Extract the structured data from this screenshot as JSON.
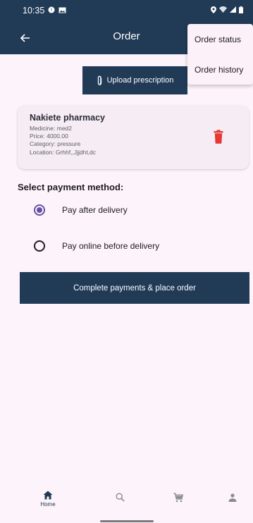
{
  "status_bar": {
    "time": "10:35"
  },
  "app_bar": {
    "title": "Order"
  },
  "menu": {
    "items": [
      "Order status",
      "Order history"
    ]
  },
  "upload": {
    "label": "Upload prescription"
  },
  "order_card": {
    "pharmacy": "Nakiete pharmacy",
    "medicine": "Medicine: med2",
    "price": "Price: 4000.00",
    "category": "Category: pressure",
    "location": "Location: Grhhf,,Jjjdht,dc"
  },
  "payment": {
    "title": "Select payment method:",
    "options": [
      "Pay after delivery",
      "Pay online before delivery"
    ],
    "selected_index": 0
  },
  "place_order": {
    "label": "Complete payments & place order"
  },
  "bottom_nav": {
    "items": [
      "Home"
    ]
  },
  "colors": {
    "primary": "#213a56",
    "radio_selected": "#6750a4",
    "delete": "#e53935",
    "background": "#fdf4fb"
  },
  "icons": [
    "back-arrow-icon",
    "paperclip-icon",
    "trash-icon",
    "home-icon",
    "search-icon",
    "cart-icon",
    "person-icon"
  ]
}
